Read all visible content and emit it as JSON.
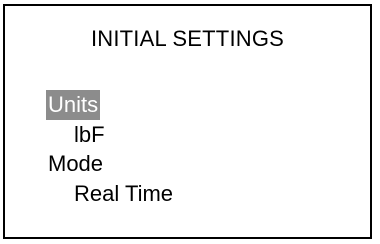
{
  "screen": {
    "title": "INITIAL SETTINGS",
    "items": [
      {
        "label": "Units",
        "selected": true
      },
      {
        "label": "lbF",
        "selected": false
      },
      {
        "label": "Mode",
        "selected": false
      },
      {
        "label": "Real Time",
        "selected": false
      }
    ],
    "colors": {
      "selection_background": "#8c8c8c",
      "selection_text": "#ffffff",
      "text": "#000000",
      "background": "#ffffff"
    }
  }
}
